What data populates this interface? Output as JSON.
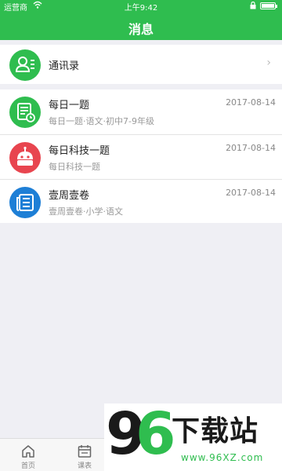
{
  "status_bar": {
    "carrier": "运营商",
    "time": "上午9:42"
  },
  "nav": {
    "title": "消息"
  },
  "contacts": {
    "label": "通讯录",
    "chevron": "›"
  },
  "messages": [
    {
      "title": "每日一题",
      "date": "2017-08-14",
      "subtitle": "每日一题·语文·初中7-9年级",
      "icon": "quiz-icon",
      "color": "#2fbd4f"
    },
    {
      "title": "每日科技一题",
      "date": "2017-08-14",
      "subtitle": "每日科技一题",
      "icon": "robot-icon",
      "color": "#e8454f"
    },
    {
      "title": "壹周壹卷",
      "date": "2017-08-14",
      "subtitle": "壹周壹卷·小学·语文",
      "icon": "paper-icon",
      "color": "#1e7fd6"
    }
  ],
  "tabbar": {
    "tabs": [
      {
        "label": "首页",
        "icon": "home-icon"
      },
      {
        "label": "课表",
        "icon": "calendar-icon"
      }
    ]
  },
  "watermark": {
    "digit1": "9",
    "digit2": "6",
    "brand": "下载站",
    "url": "www.96XZ.com"
  },
  "colors": {
    "primary": "#2fbd4f",
    "background": "#efeff4"
  }
}
